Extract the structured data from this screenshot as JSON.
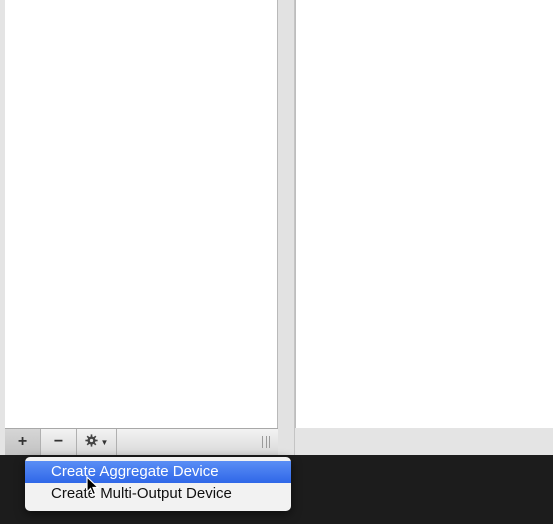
{
  "toolbar": {
    "add_label": "+",
    "remove_label": "−",
    "gear_icon": "gear-icon",
    "caret": "▼"
  },
  "menu": {
    "items": [
      {
        "label": "Create Aggregate Device",
        "selected": true
      },
      {
        "label": "Create Multi-Output Device",
        "selected": false
      }
    ]
  },
  "colors": {
    "selection": "#2f67e8",
    "window": "#e4e4e4"
  }
}
